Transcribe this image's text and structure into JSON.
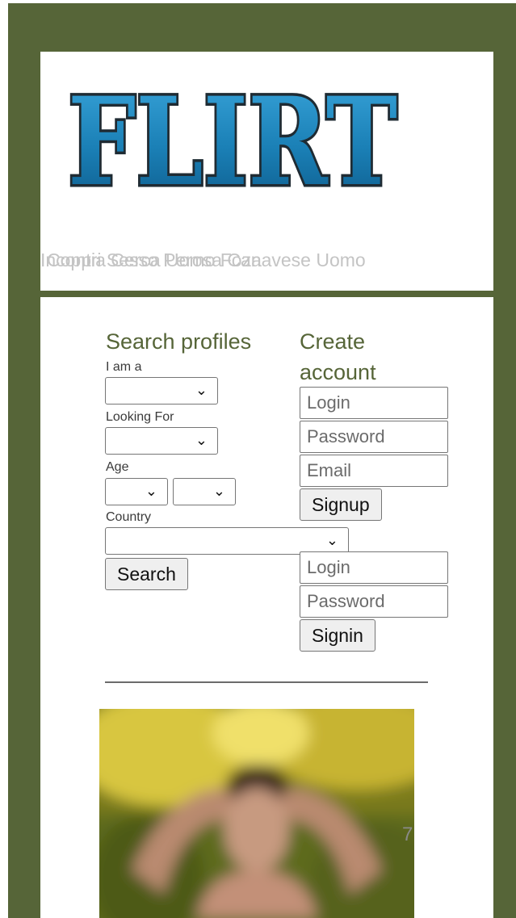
{
  "header": {
    "logo_text": "FLIRT",
    "ticker_text_1": "Incontri Sesso Perosa Canavese Uomo",
    "ticker_text_2": "Coppia Cerca Uomo Foza"
  },
  "search": {
    "title": "Search profiles",
    "i_am_label": "I am a",
    "looking_for_label": "Looking For",
    "age_label": "Age",
    "country_label": "Country",
    "search_button": "Search"
  },
  "create_account": {
    "title": "Create account",
    "login_placeholder": "Login",
    "password_placeholder": "Password",
    "email_placeholder": "Email",
    "signup_button": "Signup"
  },
  "signin": {
    "login_placeholder": "Login",
    "password_placeholder": "Password",
    "signin_button": "Signin"
  },
  "photo": {
    "overlay_number": "7"
  },
  "colors": {
    "frame": "#566538",
    "accent_text": "#566538",
    "logo_blue": "#1a7fb5"
  },
  "icons": {
    "dropdown": "chevron-down-icon"
  }
}
